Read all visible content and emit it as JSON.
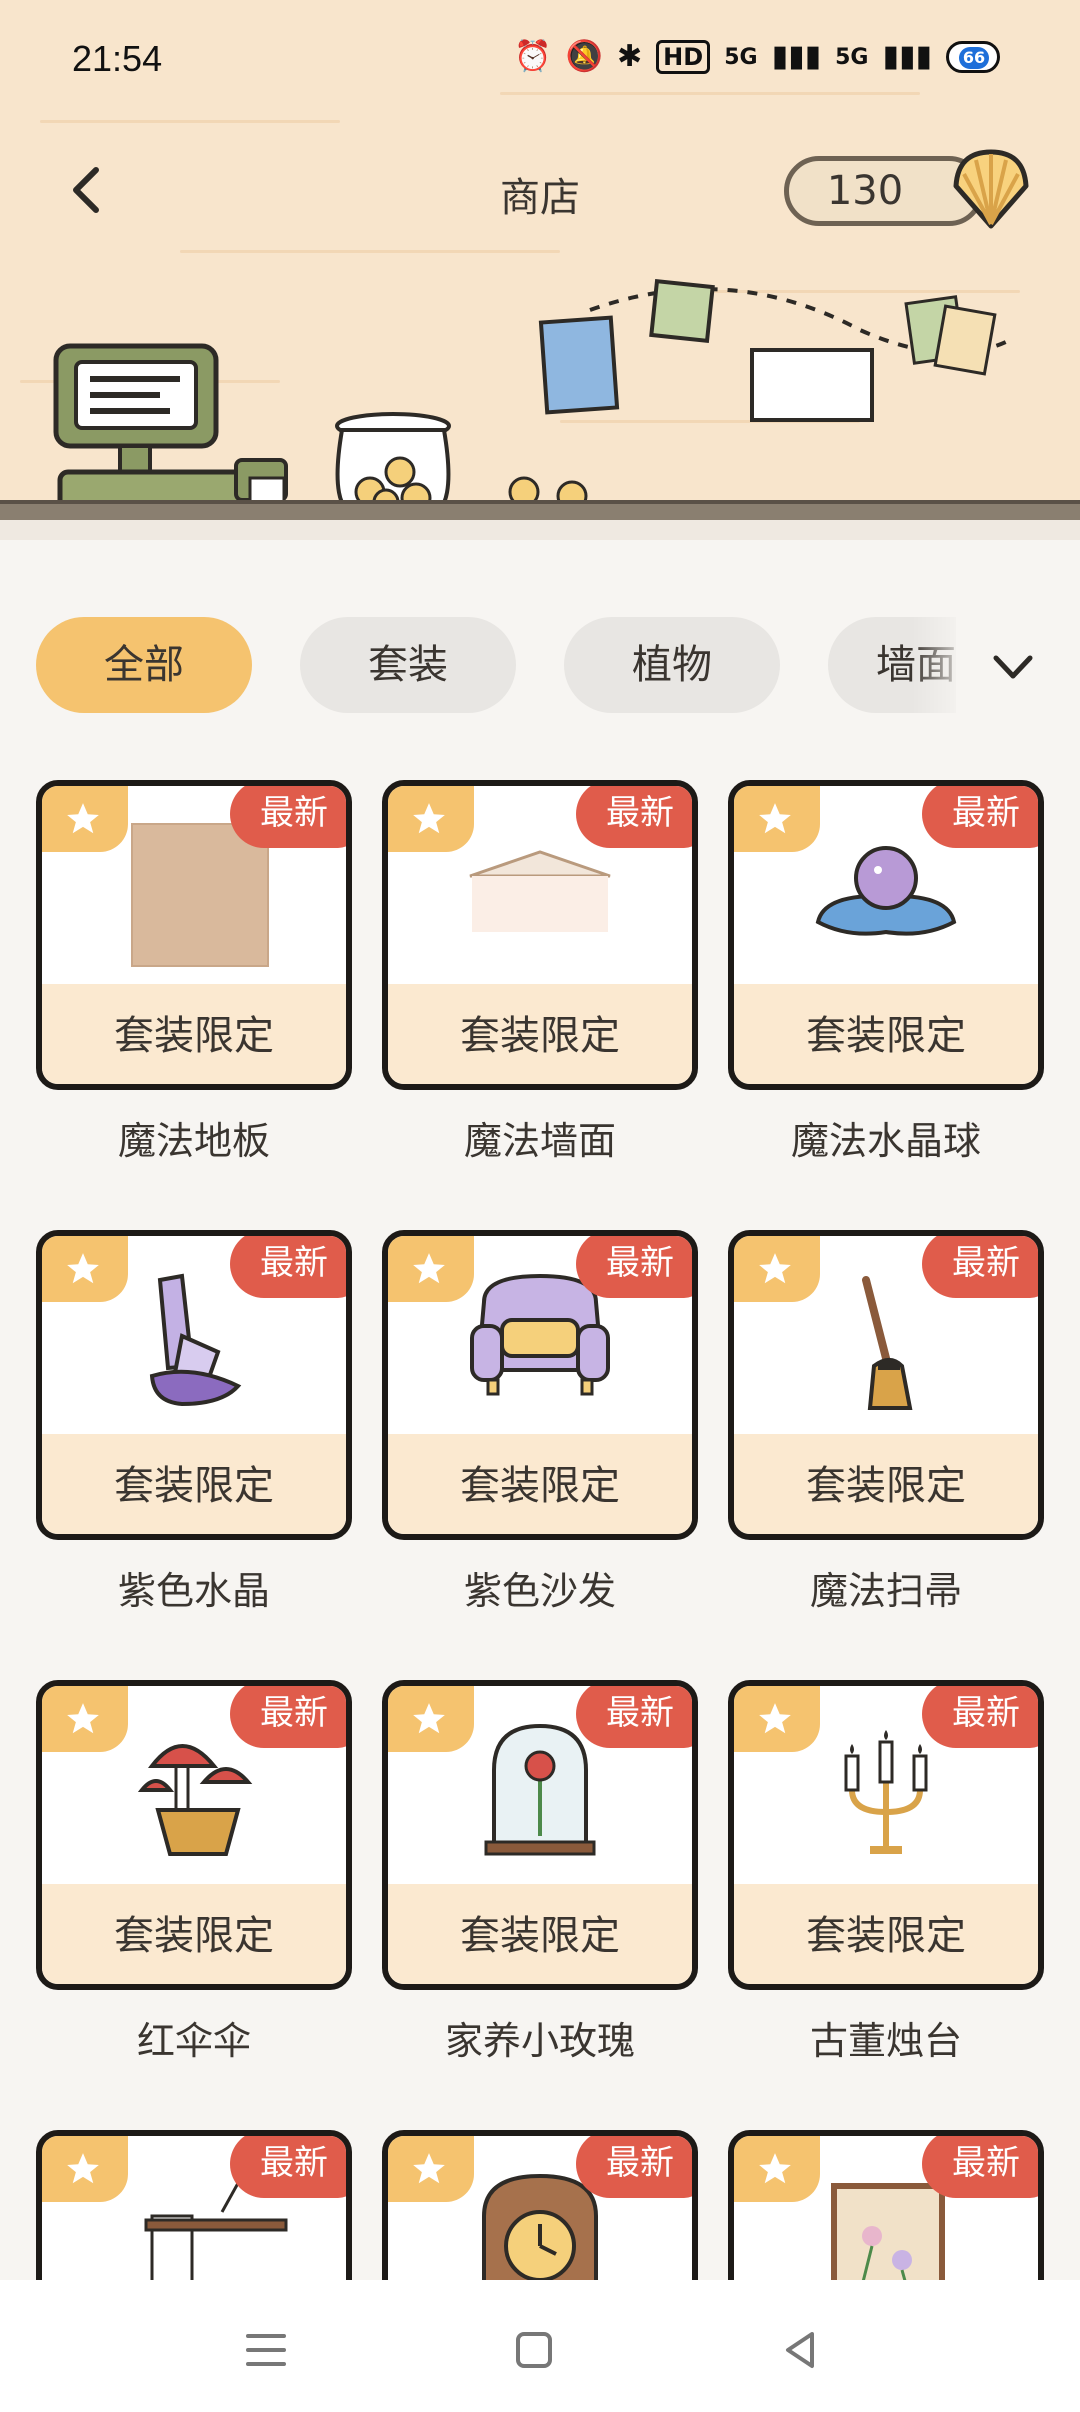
{
  "status": {
    "time": "21:54",
    "hd": "HD",
    "sig1": "5G",
    "sig2": "5G",
    "battery": "66"
  },
  "header": {
    "title": "商店",
    "coins": "130"
  },
  "tabs": [
    {
      "label": "全部",
      "active": true
    },
    {
      "label": "套装",
      "active": false
    },
    {
      "label": "植物",
      "active": false
    },
    {
      "label": "墙面装",
      "active": false
    }
  ],
  "items": [
    {
      "name": "魔法地板",
      "badge": "最新",
      "footer": "套装限定",
      "icon": "floor-icon"
    },
    {
      "name": "魔法墙面",
      "badge": "最新",
      "footer": "套装限定",
      "icon": "wall-icon"
    },
    {
      "name": "魔法水晶球",
      "badge": "最新",
      "footer": "套装限定",
      "icon": "crystal-ball-icon"
    },
    {
      "name": "紫色水晶",
      "badge": "最新",
      "footer": "套装限定",
      "icon": "purple-crystal-icon"
    },
    {
      "name": "紫色沙发",
      "badge": "最新",
      "footer": "套装限定",
      "icon": "purple-sofa-icon"
    },
    {
      "name": "魔法扫帚",
      "badge": "最新",
      "footer": "套装限定",
      "icon": "broom-icon"
    },
    {
      "name": "红伞伞",
      "badge": "最新",
      "footer": "套装限定",
      "icon": "mushroom-icon"
    },
    {
      "name": "家养小玫瑰",
      "badge": "最新",
      "footer": "套装限定",
      "icon": "rose-dome-icon"
    },
    {
      "name": "古董烛台",
      "badge": "最新",
      "footer": "套装限定",
      "icon": "candelabra-icon"
    },
    {
      "name": "",
      "badge": "最新",
      "footer": "",
      "icon": "scroll-desk-icon"
    },
    {
      "name": "",
      "badge": "最新",
      "footer": "",
      "icon": "clock-icon"
    },
    {
      "name": "",
      "badge": "最新",
      "footer": "",
      "icon": "pressed-flower-frame-icon"
    }
  ],
  "colors": {
    "accent": "#f5c36f",
    "badge_red": "#e05c4b",
    "card_footer": "#fbe9d0",
    "outline": "#1d1a17"
  }
}
